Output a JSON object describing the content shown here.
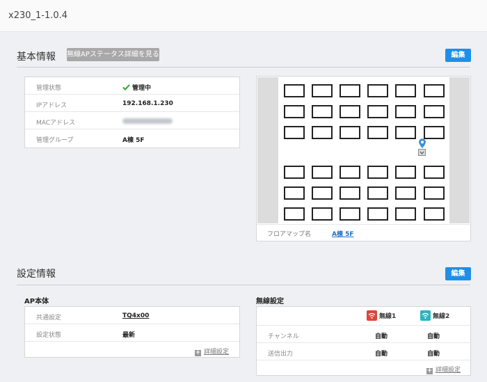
{
  "app_title": "x230_1-1.0.4",
  "basic": {
    "title": "基本情報",
    "status_button": "無線APステータス詳細を見る",
    "edit_button": "編集",
    "rows": [
      {
        "label": "管理状態",
        "value": "管理中"
      },
      {
        "label": "IPアドレス",
        "value": "192.168.1.230"
      },
      {
        "label": "MACアドレス",
        "value": ""
      },
      {
        "label": "管理グループ",
        "value": "A棟 5F"
      }
    ],
    "check_icon": "check-icon",
    "check_color": "#3ca83c"
  },
  "floormap": {
    "label": "フロアマップ名",
    "link": "A棟 5F",
    "pin_icon": "location-pin-icon",
    "ap_icon": "access-point-icon",
    "pin_color": "#3d8fd8"
  },
  "settings": {
    "title": "設定情報",
    "edit_button": "編集",
    "ap": {
      "title": "AP本体",
      "rows": [
        {
          "label": "共通設定",
          "value": "TQ4x00"
        },
        {
          "label": "設定状態",
          "value": "最新"
        }
      ],
      "detail_link": "詳細設定"
    },
    "wireless": {
      "title": "無線設定",
      "radio1": "無線1",
      "radio2": "無線2",
      "radio1_color": "#e0453a",
      "radio2_color": "#2bb5c0",
      "rows": [
        {
          "label": "チャンネル",
          "v1": "自動",
          "v2": "自動"
        },
        {
          "label": "送信出力",
          "v1": "自動",
          "v2": "自動"
        }
      ],
      "detail_link": "詳細設定"
    }
  },
  "colors": {
    "accent": "#1e8fe8",
    "link": "#1e6fc8"
  }
}
